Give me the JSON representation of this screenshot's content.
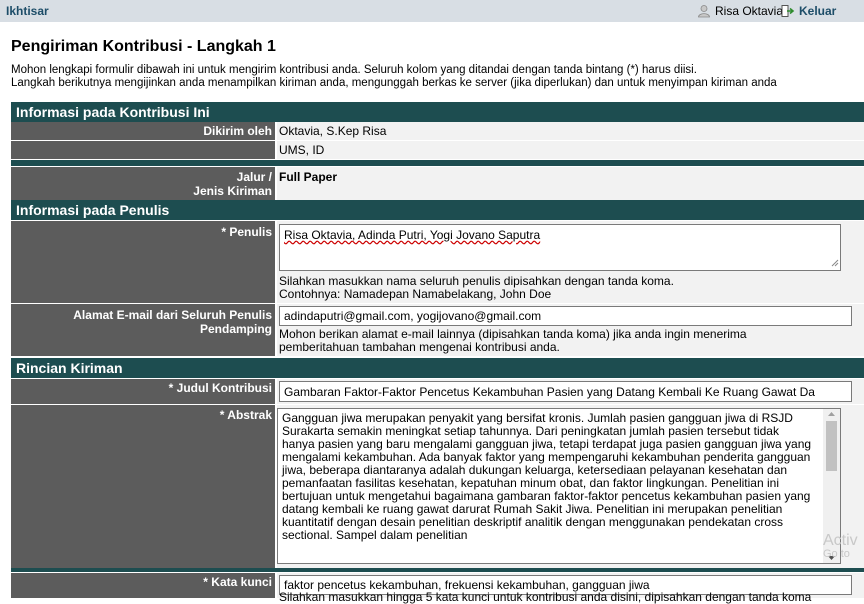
{
  "topbar": {
    "summary": "Ikhtisar",
    "user_name": "Risa Oktavia",
    "logout": "Keluar"
  },
  "page_title": "Pengiriman Kontribusi - Langkah 1",
  "intro": {
    "line1": "Mohon lengkapi formulir dibawah ini untuk mengirim kontribusi anda. Seluruh kolom yang ditandai dengan tanda bintang (*) harus diisi.",
    "line2": "Langkah berikutnya mengijinkan anda menampilkan kiriman anda, mengunggah berkas ke server (jika diperlukan) dan untuk menyimpan kiriman anda"
  },
  "section_contribution": {
    "title": "Informasi pada Kontribusi Ini",
    "sent_by_label": "Dikirim oleh",
    "sent_by_name": "Oktavia, S.Kep Risa",
    "sent_by_affiliation": "UMS, ID",
    "track_label_line1": "Jalur /",
    "track_label_line2": "Jenis Kiriman",
    "track_value": "Full Paper"
  },
  "section_authors": {
    "title": "Informasi pada Penulis",
    "authors_label": "* Penulis",
    "authors_value": "Risa Oktavia, Adinda Putri, Yogi Jovano Saputra",
    "authors_hint1": "Silahkan masukkan nama seluruh penulis dipisahkan dengan tanda koma.",
    "authors_hint2": "Contohnya: Namadepan Namabelakang, John Doe",
    "emails_label_line1": "Alamat E-mail dari Seluruh Penulis",
    "emails_label_line2": "Pendamping",
    "emails_value": "adindaputri@gmail.com, yogijovano@gmail.com",
    "emails_hint1": "Mohon berikan alamat e-mail lainnya (dipisahkan tanda koma) jika anda ingin menerima",
    "emails_hint2": "pemberitahuan tambahan mengenai kontribusi anda."
  },
  "section_details": {
    "title": "Rincian Kiriman",
    "title_label": "* Judul Kontribusi",
    "title_value": "Gambaran Faktor-Faktor Pencetus Kekambuhan Pasien yang Datang Kembali Ke Ruang Gawat Da",
    "abstract_label": "* Abstrak",
    "abstract_value": "Gangguan jiwa merupakan penyakit yang bersifat kronis. Jumlah pasien gangguan jiwa di RSJD Surakarta semakin meningkat setiap tahunnya. Dari peningkatan jumlah pasien tersebut tidak hanya pasien yang baru mengalami gangguan jiwa, tetapi terdapat juga pasien gangguan jiwa yang mengalami kekambuhan. Ada banyak faktor yang mempengaruhi kekambuhan penderita gangguan jiwa, beberapa diantaranya adalah dukungan keluarga, ketersediaan pelayanan kesehatan dan pemanfaatan fasilitas kesehatan, kepatuhan minum obat, dan faktor lingkungan. Penelitian ini bertujuan untuk mengetahui bagaimana gambaran faktor-faktor pencetus kekambuhan pasien yang datang kembali ke ruang gawat darurat Rumah Sakit Jiwa. Penelitian ini merupakan penelitian kuantitatif dengan desain penelitian deskriptif analitik dengan menggunakan pendekatan cross sectional. Sampel dalam penelitian",
    "keywords_label": "* Kata kunci",
    "keywords_value": "faktor pencetus kekambuhan, frekuensi kekambuhan, gangguan jiwa",
    "keywords_hint": "Silahkan masukkan hingga 5 kata kunci untuk kontribusi anda disini, dipisahkan dengan tanda koma"
  },
  "watermark": "Activ",
  "watermark2": "Go to"
}
